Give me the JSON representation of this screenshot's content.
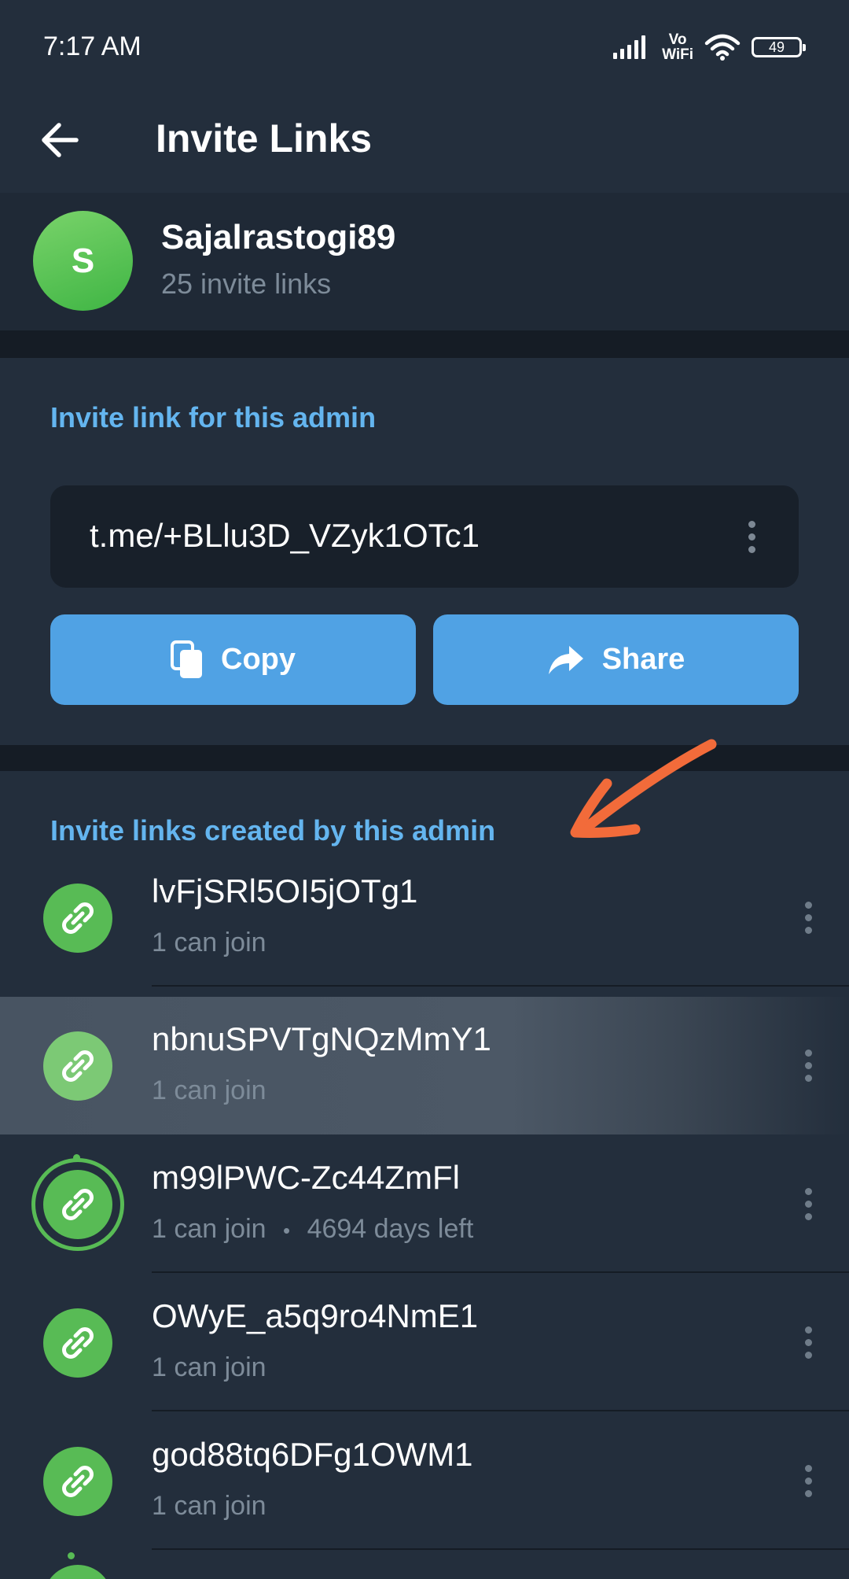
{
  "status_bar": {
    "time": "7:17 AM",
    "vowifi_top": "Vo",
    "vowifi_bottom": "WiFi",
    "battery": "49"
  },
  "header": {
    "title": "Invite Links"
  },
  "profile": {
    "avatar_letter": "S",
    "name": "Sajalrastogi89",
    "subtitle": "25 invite links"
  },
  "admin_link": {
    "section_title": "Invite link for this admin",
    "link": "t.me/+BLlu3D_VZyk1OTc1",
    "copy_label": "Copy",
    "share_label": "Share"
  },
  "created_links": {
    "section_title": "Invite links created by this admin",
    "items": [
      {
        "title": "lvFjSRl5OI5jOTg1",
        "sub": "1 can join"
      },
      {
        "title": "nbnuSPVTgNQzMmY1",
        "sub": "1 can join"
      },
      {
        "title": "m99lPWC-Zc44ZmFl",
        "sub": "1 can join",
        "dot": "•",
        "sub2": "4694 days left"
      },
      {
        "title": "OWyE_a5q9ro4NmE1",
        "sub": "1 can join"
      },
      {
        "title": "god88tq6DFg1OWM1",
        "sub": "1 can join"
      }
    ]
  },
  "colors": {
    "accent": "#64b5ef",
    "button": "#50a2e4",
    "link_icon_green": "#58bb55",
    "annotation_arrow": "#f26b3a"
  }
}
